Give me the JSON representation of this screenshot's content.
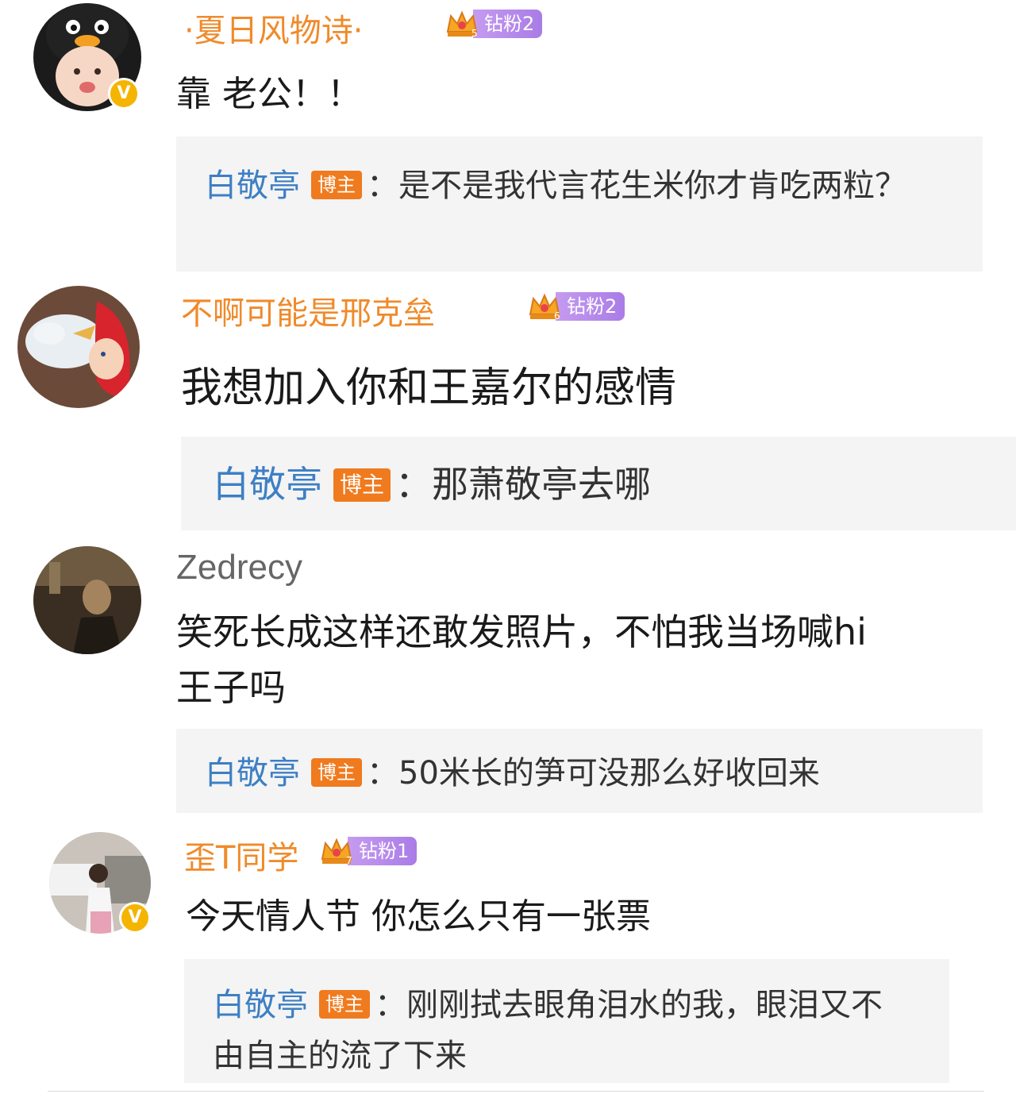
{
  "comments": [
    {
      "username": "·夏日风物诗·",
      "fan_badge": "钻粉2",
      "crown_level": "5",
      "verified": true,
      "text": "靠 老公！！",
      "reply": {
        "author": "白敬亭",
        "tag": "博主",
        "sep": "：",
        "text": "是不是我代言花生米你才肯吃两粒？"
      }
    },
    {
      "username": "不啊可能是邢克垒",
      "fan_badge": "钻粉2",
      "crown_level": "6",
      "verified": false,
      "text": "我想加入你和王嘉尔的感情",
      "reply": {
        "author": "白敬亭",
        "tag": "博主",
        "sep": "：",
        "text": "那萧敬亭去哪"
      }
    },
    {
      "username": "Zedrecy",
      "verified": false,
      "text_line1": "笑死长成这样还敢发照片，不怕我当场喊hi",
      "text_line2": "王子吗",
      "reply": {
        "author": "白敬亭",
        "tag": "博主",
        "sep": "：",
        "text": "50米长的笋可没那么好收回来"
      }
    },
    {
      "username": "歪T同学",
      "fan_badge": "钻粉1",
      "crown_level": "7",
      "verified": true,
      "text": "今天情人节 你怎么只有一张票",
      "reply": {
        "author": "白敬亭",
        "tag": "博主",
        "sep": "：",
        "text": "刚刚拭去眼角泪水的我，眼泪又不由自主的流了下来"
      }
    }
  ],
  "verified_mark": "V",
  "colors": {
    "username_orange": "#f08a2a",
    "reply_author_blue": "#3d7fc4",
    "host_tag_orange": "#f07a1e",
    "fan_badge_purple": "#b48ae8",
    "verified_gold": "#f5b400",
    "reply_bg": "#f4f4f4"
  }
}
